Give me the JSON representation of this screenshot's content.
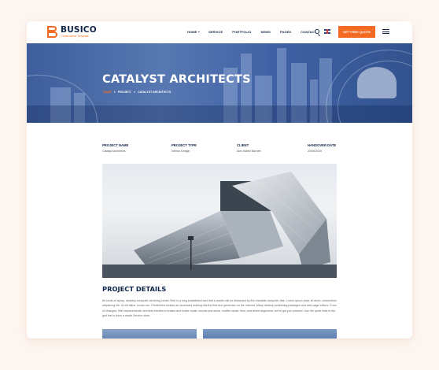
{
  "brand": {
    "name": "BUSICO",
    "tagline": "Construction Template",
    "accent_color": "#f36a22",
    "navy_color": "#0e2447"
  },
  "nav": {
    "items": [
      {
        "label": "HOME +"
      },
      {
        "label": "SERVICE"
      },
      {
        "label": "PORTFOLIO"
      },
      {
        "label": "NEWS"
      },
      {
        "label": "PAGES"
      },
      {
        "label": "CONTACT"
      }
    ],
    "search_icon": "search-icon",
    "language_icon": "uk-flag-icon",
    "cta_label": "GET FREE QUOTE",
    "menu_icon": "hamburger-menu-icon"
  },
  "hero": {
    "title": "CATALYST ARCHITECTS",
    "breadcrumb": {
      "home": "HOME",
      "separator": ">",
      "middle": "PROJECT",
      "current": "CATALYST ARCHITECTS"
    }
  },
  "project_info": [
    {
      "label": "PROJECT NAME",
      "value": "Catalyst Architects"
    },
    {
      "label": "PROJECT TYPE",
      "value": "Interior Design"
    },
    {
      "label": "CLIENT",
      "value": "Alex Martin Barnett"
    },
    {
      "label": "HANDOVER DATE",
      "value": "25/05/2029"
    }
  ],
  "details": {
    "title": "PROJECT DETAILS",
    "body": "All kinds of laptop, desktop computer servicing center Tech is a long established fact that a reader will be distracted by the readable computer disk. Lorem ipsum dolor sit amet, consectetur adipiscing elit. Ut elit tellus, luctus nec. Predefined chunks as necessary making this the first true generator on the Internet. Many desktop publishing packages and web page editors. From oil changes, filter replacements, and fluid flushes to brakes and brake repair, shocks and struts, muffler repair, tires, and wheel alignment, we've got you covered. Use the quick links in the grid bar to book a repair Service store."
  }
}
